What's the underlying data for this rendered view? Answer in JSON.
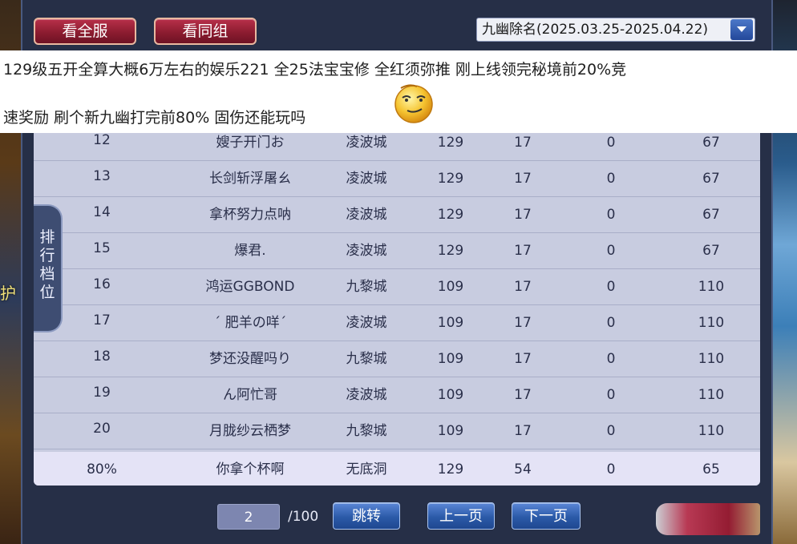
{
  "header": {
    "view_all_label": "看全服",
    "view_group_label": "看同组",
    "season_selector": "九幽除名(2025.03.25-2025.04.22)"
  },
  "overlay": {
    "line1": "129级五开全算大概6万左右的娱乐221 全25法宝宝修 全红须弥推 刚上线领完秘境前20%竞",
    "line2": "速奖励 刷个新九幽打完前80% 固伤还能玩吗"
  },
  "side_tab": {
    "label": "排行档位"
  },
  "world": {
    "left_glyph": "护"
  },
  "rows": [
    {
      "rank": "12",
      "name": "嫂子开门お",
      "server": "凌波城",
      "level": "129",
      "col_a": "17",
      "col_b": "0",
      "score": "67"
    },
    {
      "rank": "13",
      "name": "长剑斩浮屠ㄠ",
      "server": "凌波城",
      "level": "129",
      "col_a": "17",
      "col_b": "0",
      "score": "67"
    },
    {
      "rank": "14",
      "name": "拿杯努力点呐",
      "server": "凌波城",
      "level": "129",
      "col_a": "17",
      "col_b": "0",
      "score": "67"
    },
    {
      "rank": "15",
      "name": "爆君.",
      "server": "凌波城",
      "level": "129",
      "col_a": "17",
      "col_b": "0",
      "score": "67"
    },
    {
      "rank": "16",
      "name": "鸿运GGBOND",
      "server": "九黎城",
      "level": "109",
      "col_a": "17",
      "col_b": "0",
      "score": "110"
    },
    {
      "rank": "17",
      "name": "ˊ 肥羊の咩ˊ",
      "server": "凌波城",
      "level": "109",
      "col_a": "17",
      "col_b": "0",
      "score": "110"
    },
    {
      "rank": "18",
      "name": "梦还没醒吗り",
      "server": "九黎城",
      "level": "109",
      "col_a": "17",
      "col_b": "0",
      "score": "110"
    },
    {
      "rank": "19",
      "name": "ん阿忙哥",
      "server": "凌波城",
      "level": "109",
      "col_a": "17",
      "col_b": "0",
      "score": "110"
    },
    {
      "rank": "20",
      "name": "月胧纱云栖梦",
      "server": "九黎城",
      "level": "109",
      "col_a": "17",
      "col_b": "0",
      "score": "110"
    }
  ],
  "my_row": {
    "rank": "80%",
    "name": "你拿个杯啊",
    "server": "无底洞",
    "level": "129",
    "col_a": "54",
    "col_b": "0",
    "score": "65"
  },
  "pagination": {
    "current_page": "2",
    "total_pages": "/100",
    "jump_label": "跳转",
    "prev_label": "上一页",
    "next_label": "下一页"
  },
  "colors": {
    "accent_red": "#8c1c30",
    "accent_blue": "#2b5aa8",
    "table_bg": "#c8cce0",
    "highlight_row": "#e4e3f6"
  }
}
